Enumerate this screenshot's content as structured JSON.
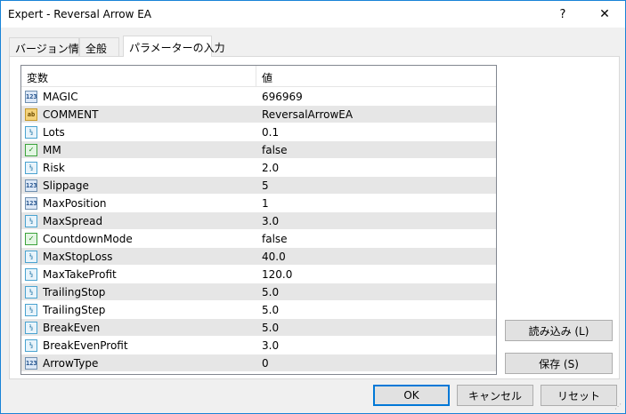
{
  "window": {
    "title": "Expert - Reversal Arrow EA",
    "help_glyph": "?",
    "close_glyph": "✕"
  },
  "tabs": [
    {
      "label": "バージョン情報"
    },
    {
      "label": "全般"
    },
    {
      "label": "パラメーターの入力",
      "selected": true
    }
  ],
  "grid": {
    "col_variable": "変数",
    "col_value": "値",
    "rows": [
      {
        "icon": "int-type-icon",
        "icon_text": "123",
        "name": "MAGIC",
        "value": "696969"
      },
      {
        "icon": "string-type-icon",
        "icon_text": "ab",
        "name": "COMMENT",
        "value": "ReversalArrowEA"
      },
      {
        "icon": "double-type-icon",
        "icon_text": "½",
        "name": "Lots",
        "value": "0.1"
      },
      {
        "icon": "bool-type-icon",
        "icon_text": "✓",
        "name": "MM",
        "value": "false"
      },
      {
        "icon": "double-type-icon",
        "icon_text": "½",
        "name": "Risk",
        "value": "2.0"
      },
      {
        "icon": "int-type-icon",
        "icon_text": "123",
        "name": "Slippage",
        "value": "5"
      },
      {
        "icon": "int-type-icon",
        "icon_text": "123",
        "name": "MaxPosition",
        "value": "1"
      },
      {
        "icon": "double-type-icon",
        "icon_text": "½",
        "name": "MaxSpread",
        "value": "3.0"
      },
      {
        "icon": "bool-type-icon",
        "icon_text": "✓",
        "name": "CountdownMode",
        "value": "false"
      },
      {
        "icon": "double-type-icon",
        "icon_text": "½",
        "name": "MaxStopLoss",
        "value": "40.0"
      },
      {
        "icon": "double-type-icon",
        "icon_text": "½",
        "name": "MaxTakeProfit",
        "value": "120.0"
      },
      {
        "icon": "double-type-icon",
        "icon_text": "½",
        "name": "TrailingStop",
        "value": "5.0"
      },
      {
        "icon": "double-type-icon",
        "icon_text": "½",
        "name": "TrailingStep",
        "value": "5.0"
      },
      {
        "icon": "double-type-icon",
        "icon_text": "½",
        "name": "BreakEven",
        "value": "5.0"
      },
      {
        "icon": "double-type-icon",
        "icon_text": "½",
        "name": "BreakEvenProfit",
        "value": "3.0"
      },
      {
        "icon": "int-type-icon",
        "icon_text": "123",
        "name": "ArrowType",
        "value": "0"
      }
    ]
  },
  "buttons": {
    "load": "読み込み (L)",
    "save": "保存 (S)",
    "ok": "OK",
    "cancel": "キャンセル",
    "reset": "リセット"
  },
  "colors": {
    "window_border": "#1883d7",
    "default_button_border": "#0078d7",
    "row_alt": "#e6e6e6"
  }
}
